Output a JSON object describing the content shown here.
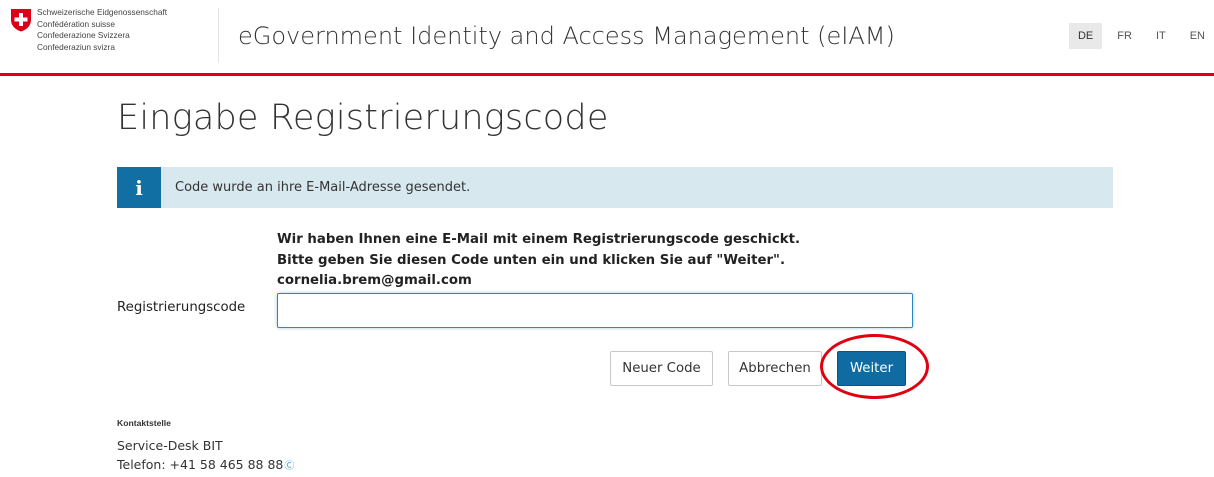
{
  "header": {
    "confederation_lines": [
      "Schweizerische Eidgenossenschaft",
      "Confédération suisse",
      "Confederazione Svizzera",
      "Confederaziun svizra"
    ],
    "app_title": "eGovernment Identity and Access Management (eIAM)",
    "languages": [
      "DE",
      "FR",
      "IT",
      "EN"
    ],
    "active_language": "DE",
    "accent_color": "#dc0018"
  },
  "main": {
    "page_title": "Eingabe Registrierungscode",
    "alert": {
      "icon": "info-icon",
      "text": "Code wurde an ihre E-Mail-Adresse gesendet."
    },
    "intro_lines": [
      "Wir haben Ihnen eine E-Mail mit einem Registrierungscode geschickt.",
      "Bitte geben Sie diesen Code unten ein und klicken Sie auf \"Weiter\".",
      "cornelia.brem@gmail.com"
    ],
    "field_label": "Registrierungscode",
    "field_value": "",
    "buttons": {
      "new_code": "Neuer Code",
      "cancel": "Abbrechen",
      "next": "Weiter"
    },
    "primary_color": "#106ba3"
  },
  "contact": {
    "heading": "Kontaktstelle",
    "name": "Service-Desk BIT",
    "phone": "Telefon: +41 58 465 88 88",
    "phone_icon": "phone-call-icon"
  }
}
